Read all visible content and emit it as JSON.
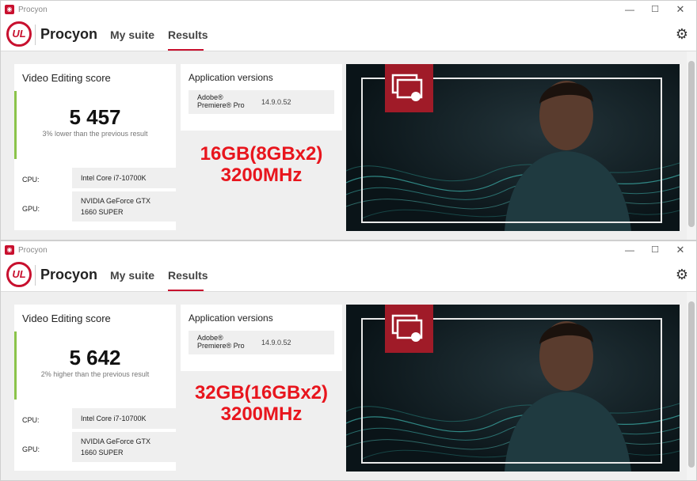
{
  "colors": {
    "accent": "#c8102e",
    "score_bar": "#8bc34a",
    "annotation": "#e8151d"
  },
  "windows": [
    {
      "titlebar": {
        "title": "Procyon",
        "min": "—",
        "max": "☐",
        "close": "✕"
      },
      "nav": {
        "logo": "UL",
        "brand": "Procyon",
        "tabs": [
          "My suite",
          "Results"
        ],
        "active_tab": "Results",
        "settings_icon": "gear-icon"
      },
      "score": {
        "title": "Video Editing score",
        "value": "5 457",
        "comparison": "3% lower than the previous result",
        "cpu_label": "CPU:",
        "cpu": "Intel Core i7-10700K",
        "gpu_label": "GPU:",
        "gpu": "NVIDIA GeForce GTX\n1660 SUPER"
      },
      "apps": {
        "title": "Application versions",
        "name": "Adobe®\nPremiere® Pro",
        "version": "14.9.0.52"
      },
      "annotation": {
        "line1": "16GB(8GBx2)",
        "line2": "3200MHz"
      }
    },
    {
      "titlebar": {
        "title": "Procyon",
        "min": "—",
        "max": "☐",
        "close": "✕"
      },
      "nav": {
        "logo": "UL",
        "brand": "Procyon",
        "tabs": [
          "My suite",
          "Results"
        ],
        "active_tab": "Results",
        "settings_icon": "gear-icon"
      },
      "score": {
        "title": "Video Editing score",
        "value": "5 642",
        "comparison": "2% higher than the previous result",
        "cpu_label": "CPU:",
        "cpu": "Intel Core i7-10700K",
        "gpu_label": "GPU:",
        "gpu": "NVIDIA GeForce GTX\n1660 SUPER"
      },
      "apps": {
        "title": "Application versions",
        "name": "Adobe®\nPremiere® Pro",
        "version": "14.9.0.52"
      },
      "annotation": {
        "line1": "32GB(16GBx2)",
        "line2": "3200MHz"
      }
    }
  ]
}
